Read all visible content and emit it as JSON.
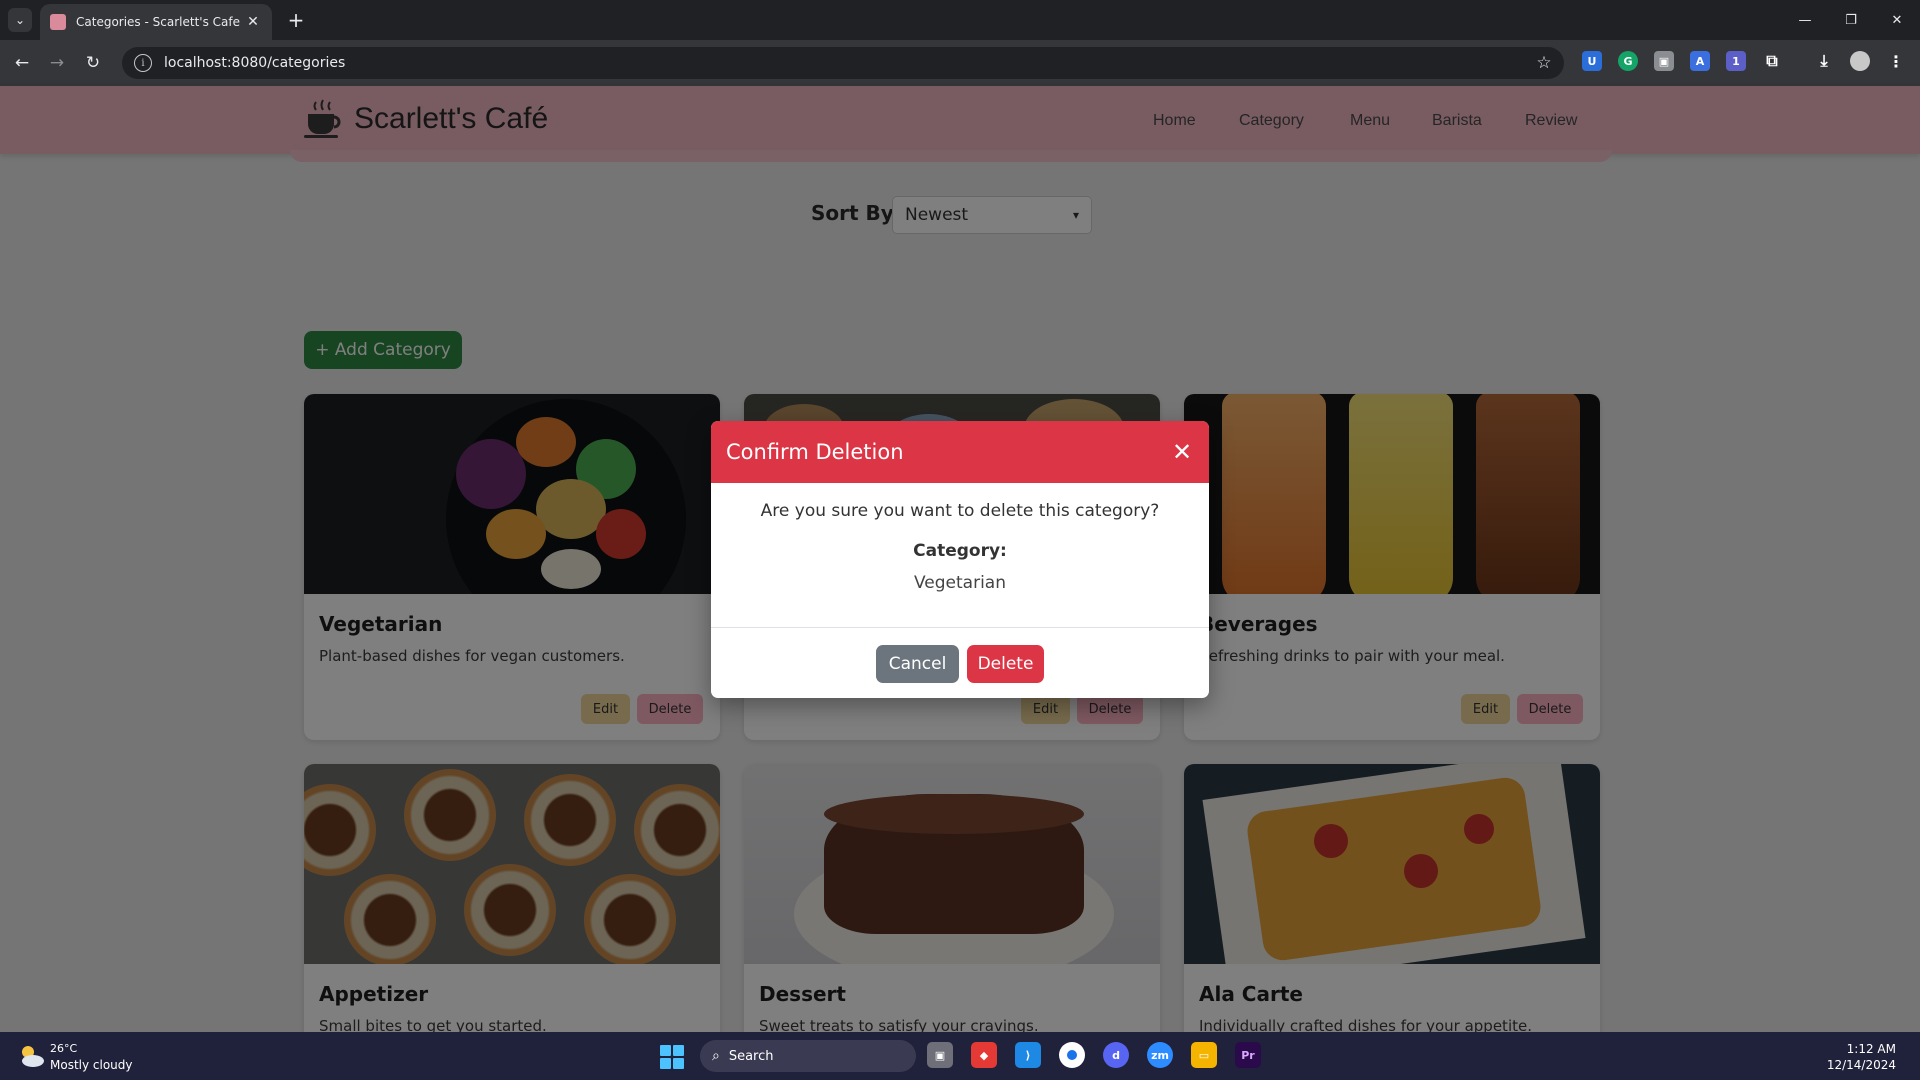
{
  "browser": {
    "tab_title": "Categories - Scarlett's Cafe",
    "url": "localhost:8080/categories"
  },
  "site": {
    "brand": "Scarlett's Café",
    "nav": [
      "Home",
      "Category",
      "Menu",
      "Barista",
      "Review"
    ],
    "sort_label": "Sort By:",
    "sort_value": "Newest",
    "add_button": "+ Add Category"
  },
  "cards": [
    {
      "title": "Vegetarian",
      "description": "Plant-based dishes for vegan customers.",
      "edit": "Edit",
      "delete": "Delete"
    },
    {
      "title": "",
      "description": "",
      "edit": "Edit",
      "delete": "Delete"
    },
    {
      "title": "Beverages",
      "description": "Refreshing drinks to pair with your meal.",
      "edit": "Edit",
      "delete": "Delete"
    },
    {
      "title": "Appetizer",
      "description": "Small bites to get you started.",
      "edit": "Edit",
      "delete": "Delete"
    },
    {
      "title": "Dessert",
      "description": "Sweet treats to satisfy your cravings.",
      "edit": "Edit",
      "delete": "Delete"
    },
    {
      "title": "Ala Carte",
      "description": "Individually crafted dishes for your appetite.",
      "edit": "Edit",
      "delete": "Delete"
    }
  ],
  "modal": {
    "title": "Confirm Deletion",
    "message": "Are you sure you want to delete this category?",
    "category_label": "Category:",
    "category_value": "Vegetarian",
    "cancel": "Cancel",
    "delete": "Delete"
  },
  "taskbar": {
    "temperature": "26°C",
    "weather": "Mostly cloudy",
    "search": "Search",
    "time": "1:12 AM",
    "date": "12/14/2024"
  },
  "colors": {
    "header": "#f0b8c5",
    "add_button": "#2e8a45",
    "edit_button": "#f0d79a",
    "delete_button": "#ffb3c4",
    "modal_header": "#dc3545",
    "cancel_button": "#6c757d"
  }
}
